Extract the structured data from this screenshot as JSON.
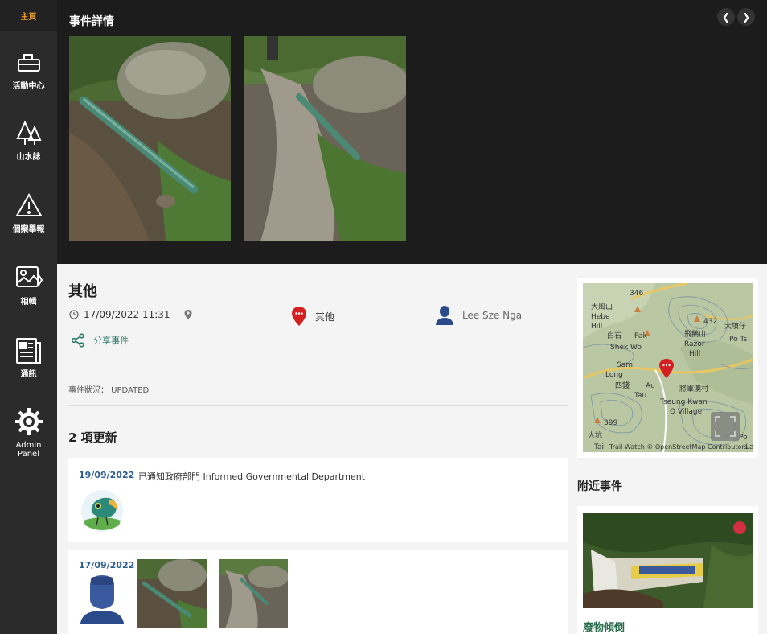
{
  "sidebar": {
    "home": "主頁",
    "items": [
      {
        "label": "活動中心",
        "icon": "activity-icon"
      },
      {
        "label": "山水誌",
        "icon": "trees-icon"
      },
      {
        "label": "個案舉報",
        "icon": "warning-icon"
      },
      {
        "label": "相輯",
        "icon": "album-icon"
      },
      {
        "label": "通訊",
        "icon": "newsletter-icon"
      },
      {
        "label": "Admin Panel",
        "icon": "gear-icon"
      }
    ]
  },
  "gallery": {
    "title": "事件詳情"
  },
  "event": {
    "title": "其他",
    "datetime": "17/09/2022 11:31",
    "category": "其他",
    "reporter": "Lee Sze Nga",
    "share_label": "分享事件",
    "status": "事件狀況： UPDATED"
  },
  "updates": {
    "title": "2 項更新",
    "items": [
      {
        "date": "19/09/2022",
        "text": "已通知政府部門 Informed Governmental Department"
      },
      {
        "date": "17/09/2022",
        "text": ""
      }
    ]
  },
  "map": {
    "attribution": "Trail Watch © OpenStreetMap Contributors",
    "labels": [
      "346",
      "大風山",
      "Hebe",
      "Hill",
      "白石",
      "Pak",
      "Shek Wo",
      "大墳仔",
      "432",
      "Po Ts",
      "飛鵝山",
      "Razor",
      "Hill",
      "Sam",
      "Long",
      "四錢",
      "Au",
      "Tau",
      "將軍澳村",
      "Tseung Kwan",
      "O Village",
      "399",
      "Po",
      "Lam",
      "大坑",
      "Tai"
    ]
  },
  "nearby": {
    "title": "附近事件",
    "item_label": "廢物傾倒"
  },
  "colors": {
    "accent": "#2d7a6a",
    "date": "#2b5d91",
    "pin": "#d42020",
    "home": "#f0a030"
  }
}
